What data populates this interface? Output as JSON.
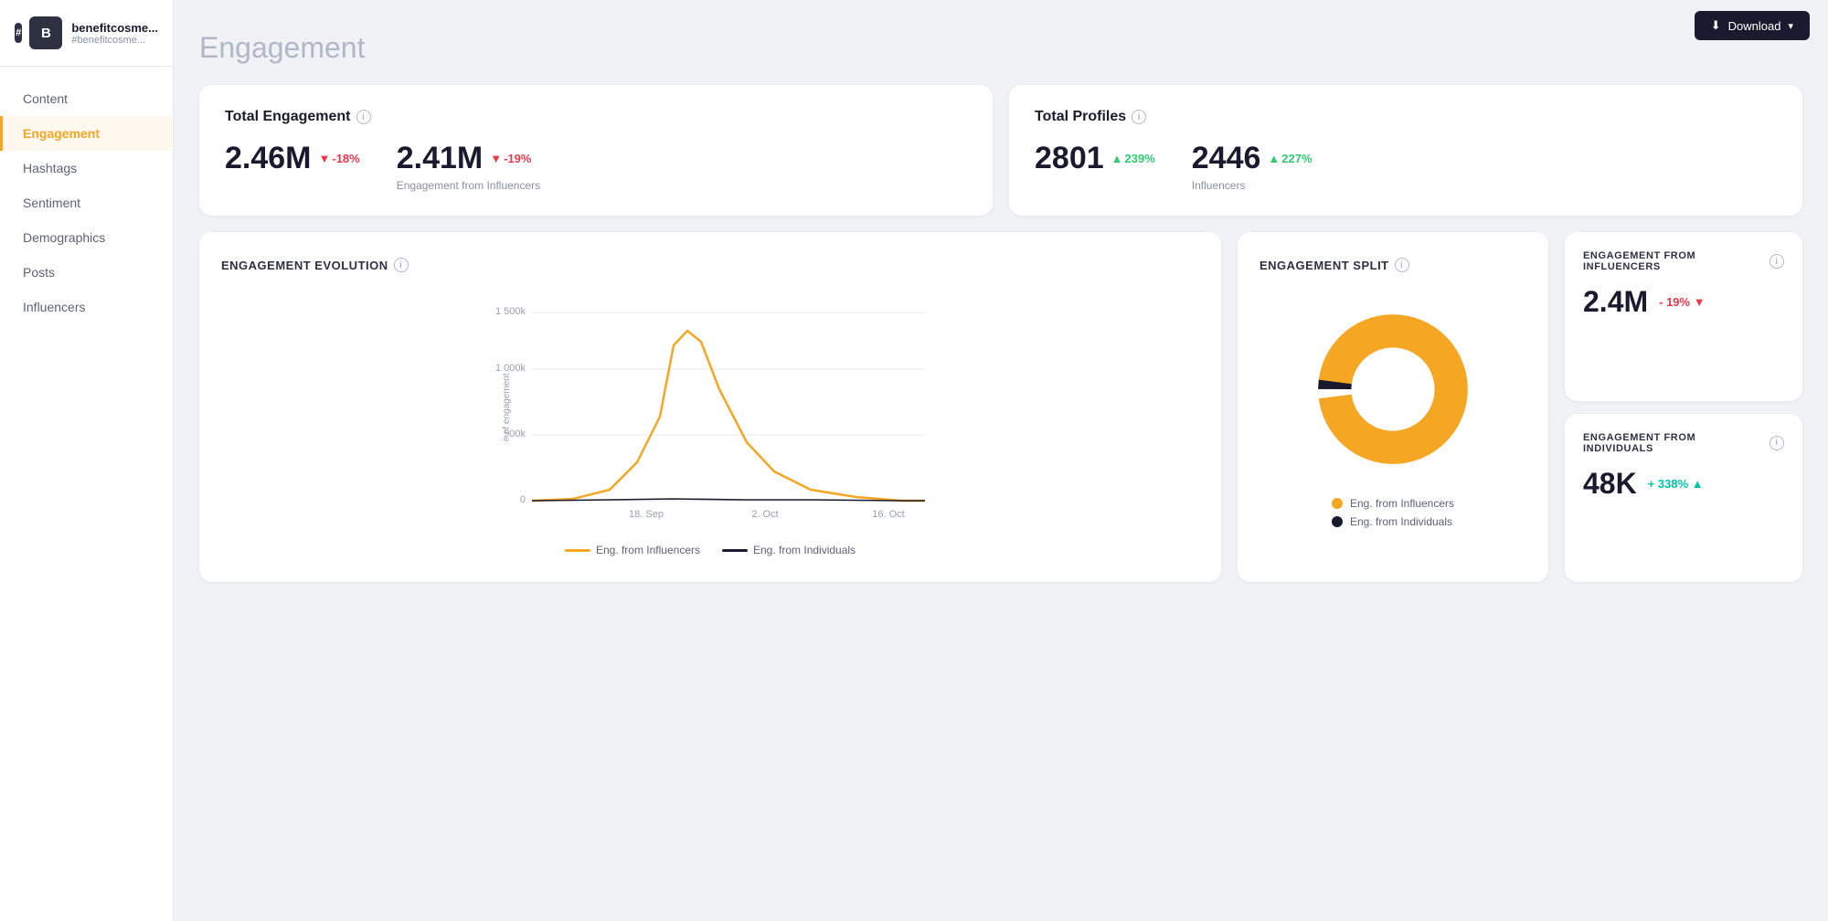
{
  "sidebar": {
    "avatar_letter": "B",
    "brand_name": "benefitcosme...",
    "brand_handle": "#benefitcosme...",
    "nav_items": [
      {
        "label": "Content",
        "active": false
      },
      {
        "label": "Engagement",
        "active": true
      },
      {
        "label": "Hashtags",
        "active": false
      },
      {
        "label": "Sentiment",
        "active": false
      },
      {
        "label": "Demographics",
        "active": false
      },
      {
        "label": "Posts",
        "active": false
      },
      {
        "label": "Influencers",
        "active": false
      }
    ]
  },
  "header": {
    "page_title": "Engagement",
    "download_label": "Download"
  },
  "total_engagement_card": {
    "title": "Total Engagement",
    "value1": "2.46M",
    "change1": "-18%",
    "value2": "2.41M",
    "change2": "-19%",
    "sub2": "Engagement from Influencers"
  },
  "total_profiles_card": {
    "title": "Total Profiles",
    "value1": "2801",
    "change1": "239%",
    "value2": "2446",
    "change2": "227%",
    "sub2": "Influencers"
  },
  "engagement_evolution": {
    "title": "ENGAGEMENT EVOLUTION",
    "y_labels": [
      "1 500k",
      "1 000k",
      "500k",
      "0"
    ],
    "x_labels": [
      "18. Sep",
      "2. Oct",
      "16. Oct"
    ],
    "legend_influencers": "Eng. from Influencers",
    "legend_individuals": "Eng. from Individuals"
  },
  "engagement_split": {
    "title": "ENGAGEMENT SPLIT",
    "legend_influencers": "Eng. from Influencers",
    "legend_individuals": "Eng. from Individuals",
    "influencer_pct": 98,
    "individual_pct": 2
  },
  "side_card_influencers": {
    "title": "ENGAGEMENT FROM INFLUENCERS",
    "value": "2.4M",
    "change": "- 19%"
  },
  "side_card_individuals": {
    "title": "ENGAGEMENT FROM INDIVIDUALS",
    "value": "48K",
    "change": "+ 338%"
  }
}
